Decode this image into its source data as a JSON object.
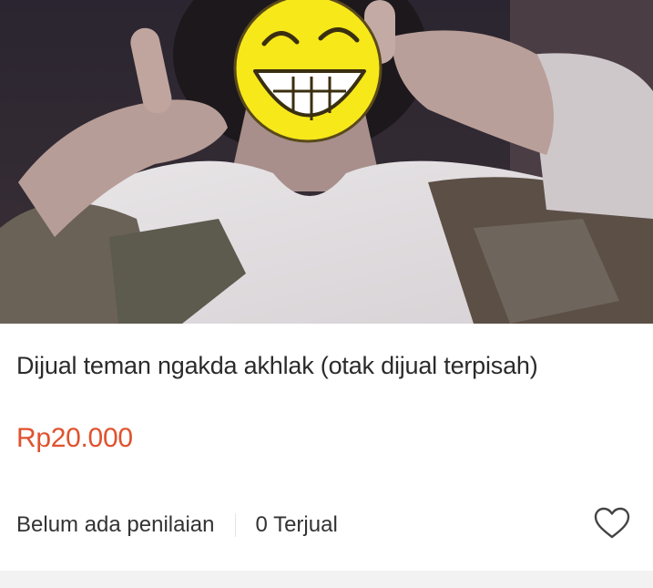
{
  "product": {
    "title": "Dijual teman ngakda akhlak (otak dijual terpisah)",
    "price": "Rp20.000",
    "rating_text": "Belum ada penilaian",
    "sold_text": "0 Terjual",
    "wishlist_icon": "heart-outline-icon"
  },
  "colors": {
    "price": "#e0522e",
    "text": "#2b2b2b",
    "emoji_face": "#f7e81a"
  }
}
